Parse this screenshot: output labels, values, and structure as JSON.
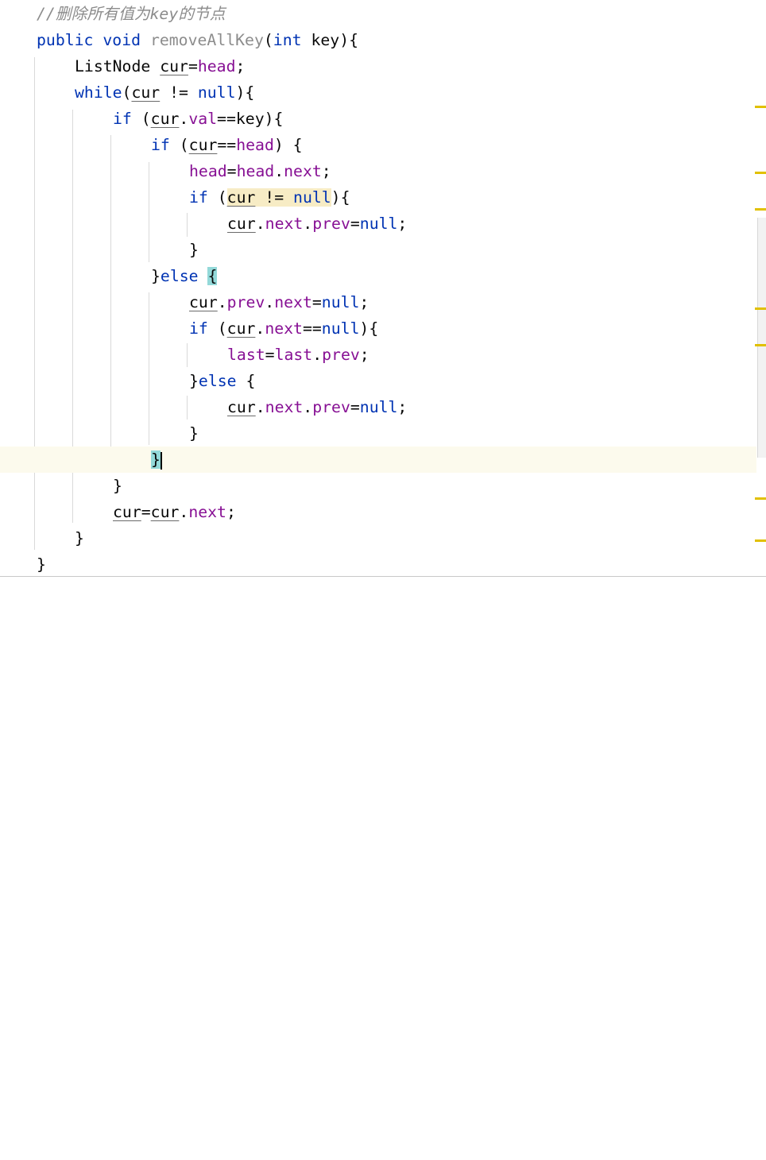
{
  "editor": {
    "comment": "//删除所有值为key的节点",
    "kw": {
      "public": "public",
      "void": "void",
      "int": "int",
      "while": "while",
      "if": "if",
      "else": "else",
      "null": "null"
    },
    "method_name": "removeAllKey",
    "param": "key",
    "type_ListNode": "ListNode",
    "var_cur": "cur",
    "field_head": "head",
    "field_next": "next",
    "field_prev": "prev",
    "field_val": "val",
    "field_last": "last"
  }
}
